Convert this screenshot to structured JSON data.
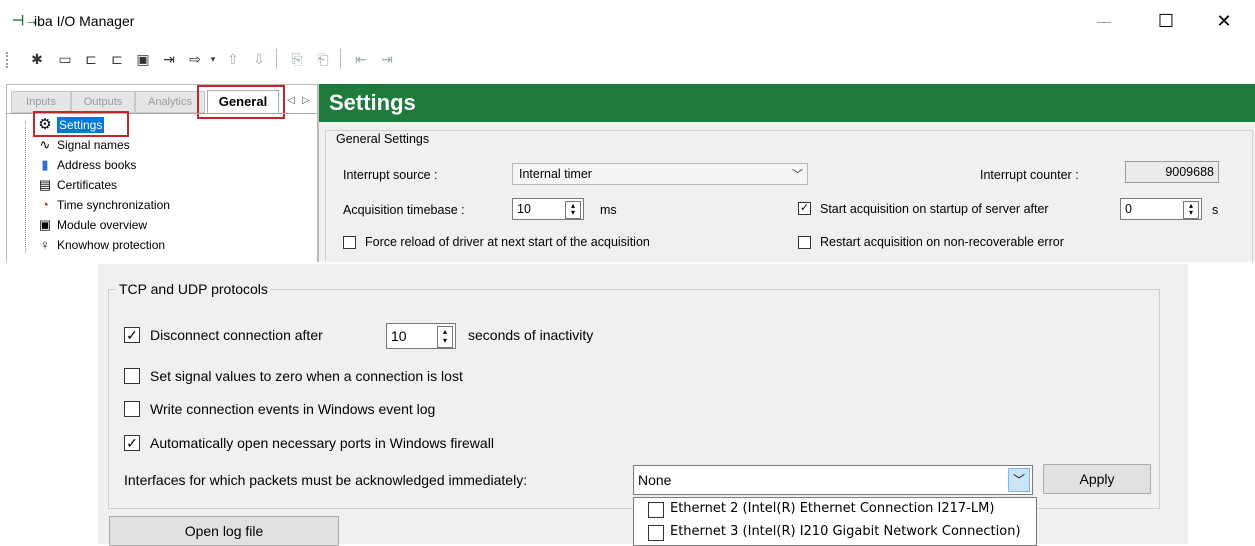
{
  "window": {
    "title": "iba I/O Manager",
    "app_icon": "io-manager-icon",
    "minimize": "—",
    "maximize": "☐",
    "close": "✕"
  },
  "toolbar": {
    "icons": [
      "new-icon",
      "open-folder-icon",
      "save-server-icon",
      "save-client-icon",
      "save-icon",
      "import-icon",
      "export-icon",
      "move-up-icon",
      "move-down-icon",
      "copy-icon",
      "paste-icon",
      "back-icon",
      "forward-icon"
    ]
  },
  "tabs": {
    "inputs": "Inputs",
    "outputs": "Outputs",
    "analytics": "Analytics",
    "general": "General",
    "prev": "◁",
    "next": "▷"
  },
  "tree": [
    {
      "label": "Settings",
      "icon": "gear-icon",
      "glyph": "⚙",
      "selected": true
    },
    {
      "label": "Signal names",
      "icon": "signal-icon",
      "glyph": "∿",
      "selected": false
    },
    {
      "label": "Address books",
      "icon": "book-icon",
      "glyph": "▮",
      "selected": false
    },
    {
      "label": "Certificates",
      "icon": "certificate-icon",
      "glyph": "▤",
      "selected": false
    },
    {
      "label": "Time synchronization",
      "icon": "clock-icon",
      "glyph": "◔",
      "selected": false
    },
    {
      "label": "Module overview",
      "icon": "module-overview-icon",
      "glyph": "▣",
      "selected": false
    },
    {
      "label": "Knowhow protection",
      "icon": "key-icon",
      "glyph": "♀",
      "selected": false
    }
  ],
  "settings": {
    "header": "Settings",
    "general_group": "General Settings",
    "interrupt_source_label": "Interrupt source :",
    "interrupt_source_value": "Internal timer",
    "interrupt_counter_label": "Interrupt counter :",
    "interrupt_counter_value": "9009688",
    "timebase_label": "Acquisition timebase :",
    "timebase_value": "10",
    "timebase_unit": "ms",
    "start_on_startup_label": "Start acquisition on startup of server after",
    "start_on_startup_checked": true,
    "start_delay_value": "0",
    "start_delay_unit": "s",
    "force_reload_label": "Force reload of driver at next start of the acquisition",
    "force_reload_checked": false,
    "restart_label": "Restart acquisition on non-recoverable error",
    "restart_checked": false
  },
  "tcp": {
    "group_title": "TCP and UDP protocols",
    "disconnect_label": "Disconnect connection after",
    "disconnect_checked": true,
    "disconnect_value": "10",
    "disconnect_suffix": "seconds of inactivity",
    "zero_label": "Set signal values to zero when a connection is lost",
    "zero_checked": false,
    "eventlog_label": "Write connection events in Windows event log",
    "eventlog_checked": false,
    "firewall_label": "Automatically open necessary ports in Windows firewall",
    "firewall_checked": true,
    "interfaces_label": "Interfaces for which packets must be acknowledged immediately:",
    "interfaces_value": "None",
    "apply_label": "Apply",
    "open_log_label": "Open log file",
    "dropdown_options": [
      {
        "label": "Ethernet 2 (Intel(R) Ethernet Connection I217-LM)",
        "checked": false
      },
      {
        "label": "Ethernet 3 (Intel(R) I210 Gigabit Network Connection)",
        "checked": false
      }
    ]
  },
  "colors": {
    "header_green": "#1e7b3b",
    "highlight_red": "#c0282d",
    "selection_blue": "#0078d7"
  }
}
